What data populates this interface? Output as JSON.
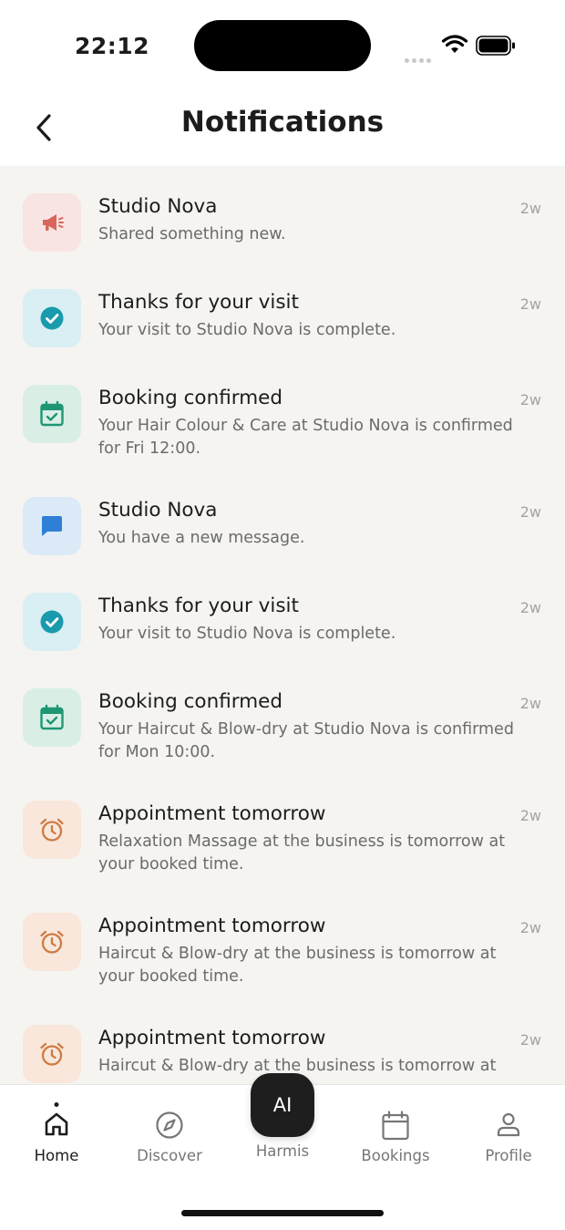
{
  "status_bar": {
    "time": "22:12"
  },
  "header": {
    "title": "Notifications"
  },
  "notifications": [
    {
      "icon": "megaphone-icon",
      "tint": "#f8e4e2",
      "color": "#d9665c",
      "title": "Studio Nova",
      "body": "Shared something new.",
      "time": "2w"
    },
    {
      "icon": "check-circle-icon",
      "tint": "#d9eff3",
      "color": "#1a9aad",
      "title": "Thanks for your visit",
      "body": "Your visit to Studio Nova is complete.",
      "time": "2w"
    },
    {
      "icon": "calendar-check-icon",
      "tint": "#d9efe6",
      "color": "#1f9673",
      "title": "Booking confirmed",
      "body": "Your Hair Colour & Care at Studio Nova is confirmed for Fri 12:00.",
      "time": "2w"
    },
    {
      "icon": "chat-bubble-icon",
      "tint": "#dceaf7",
      "color": "#2f7fd6",
      "title": "Studio Nova",
      "body": "You have a new message.",
      "time": "2w"
    },
    {
      "icon": "check-circle-icon",
      "tint": "#d9eff3",
      "color": "#1a9aad",
      "title": "Thanks for your visit",
      "body": "Your visit to Studio Nova is complete.",
      "time": "2w"
    },
    {
      "icon": "calendar-check-icon",
      "tint": "#d9efe6",
      "color": "#1f9673",
      "title": "Booking confirmed",
      "body": "Your Haircut & Blow-dry at Studio Nova is confirmed for Mon 10:00.",
      "time": "2w"
    },
    {
      "icon": "alarm-clock-icon",
      "tint": "#f8e7da",
      "color": "#cf7a43",
      "title": "Appointment tomorrow",
      "body": "Relaxation Massage at the business is tomorrow at your booked time.",
      "time": "2w"
    },
    {
      "icon": "alarm-clock-icon",
      "tint": "#f8e7da",
      "color": "#cf7a43",
      "title": "Appointment tomorrow",
      "body": "Haircut & Blow-dry at the business is tomorrow at your booked time.",
      "time": "2w"
    },
    {
      "icon": "alarm-clock-icon",
      "tint": "#f8e7da",
      "color": "#cf7a43",
      "title": "Appointment tomorrow",
      "body": "Haircut & Blow-dry at the business is tomorrow at",
      "time": "2w"
    }
  ],
  "tabbar": {
    "home": "Home",
    "discover": "Discover",
    "ai_button": "AI",
    "ai_label": "Harmis",
    "bookings": "Bookings",
    "profile": "Profile",
    "active": "home"
  }
}
